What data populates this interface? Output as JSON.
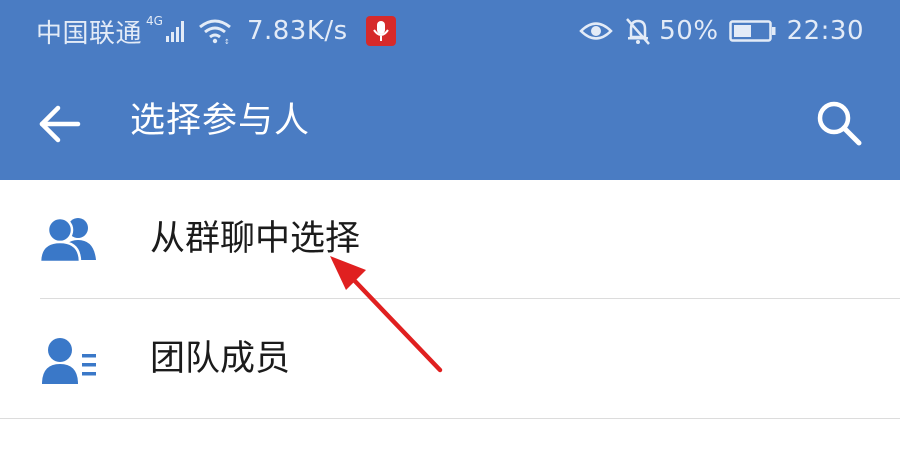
{
  "status_bar": {
    "carrier": "中国联通",
    "network_type": "4G",
    "speed": "7.83K/s",
    "battery": "50%",
    "time": "22:30"
  },
  "app_bar": {
    "title": "选择参与人"
  },
  "list": {
    "items": [
      {
        "label": "从群聊中选择",
        "icon": "group-icon"
      },
      {
        "label": "团队成员",
        "icon": "contact-list-icon"
      }
    ]
  },
  "colors": {
    "app_bar_bg": "#4a7cc3",
    "icon_blue": "#3a78c8",
    "annotation_arrow": "#e02020"
  }
}
